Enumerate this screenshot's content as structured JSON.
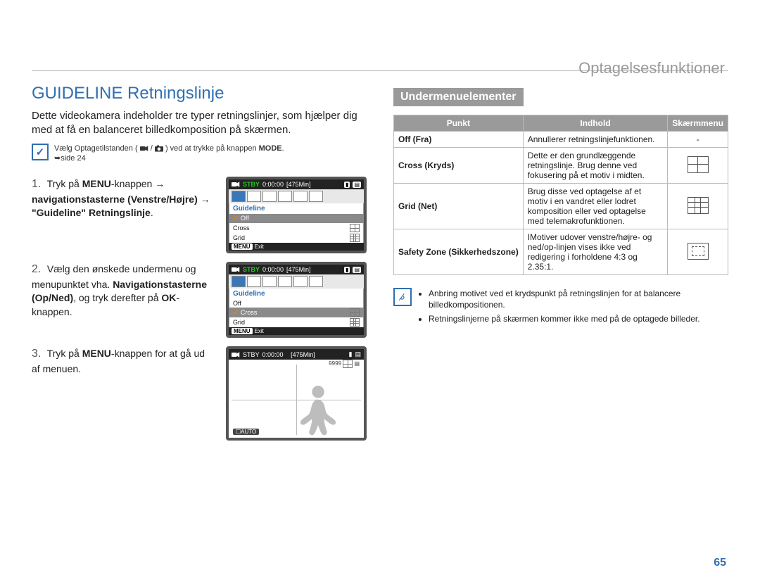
{
  "header": {
    "section": "Optagelsesfunktioner"
  },
  "page_number": "65",
  "left": {
    "title": "GUIDELINE Retningslinje",
    "intro": "Dette videokamera indeholder tre typer retningslinjer, som hjælper dig med at få en balanceret billedkomposition på skærmen.",
    "mode_note_pre": "Vælg Optagetilstanden (",
    "mode_note_mid": " / ",
    "mode_note_post": ") ved at trykke på knappen ",
    "mode_btn": "MODE",
    "mode_note_end": ".",
    "page_ref": "➥side 24",
    "step1_num": "1.",
    "step1_a": "Tryk på ",
    "step1_menu": "MENU",
    "step1_b": "-knappen → ",
    "step1_c": "navigationstasterne (Venstre/Højre) → \"Guideline\" Retningslinje",
    "step1_d": ".",
    "step2_num": "2.",
    "step2_a": "Vælg den ønskede undermenu og menupunktet vha. ",
    "step2_b": "Navigationstasterne (Op/Ned)",
    "step2_c": ", og tryk derefter på ",
    "step2_ok": "OK",
    "step2_d": "-knappen.",
    "step3_num": "3.",
    "step3_a": "Tryk på ",
    "step3_menu": "MENU",
    "step3_b": "-knappen for at gå ud af menuen."
  },
  "lcd": {
    "stby": "STBY",
    "time": "0:00:00",
    "remain": "[475Min]",
    "count": "9999",
    "menu_title": "Guideline",
    "off": "Off",
    "cross": "Cross",
    "grid": "Grid",
    "menu_btn": "MENU",
    "exit": "Exit",
    "auto": "☐AUTO"
  },
  "right": {
    "sub_heading": "Undermenuelementer",
    "th1": "Punkt",
    "th2": "Indhold",
    "th3": "Skærmmenu",
    "rows": [
      {
        "pt": "Off (Fra)",
        "desc": "Annullerer retningslinjefunktionen.",
        "icon": "none",
        "dash": "-"
      },
      {
        "pt": "Cross (Kryds)",
        "desc": "Dette er den grundlæggende retningslinje. Brug denne ved fokusering på et motiv i midten.",
        "icon": "cross"
      },
      {
        "pt": "Grid (Net)",
        "desc": "Brug disse ved optagelse af et motiv i en vandret eller lodret komposition eller ved optagelse med telemakrofunktionen.",
        "icon": "grid"
      },
      {
        "pt": "Safety Zone (Sikkerhedszone)",
        "desc": "IMotiver udover venstre/højre- og ned/op-linjen vises ikke ved redigering i forholdene 4:3 og 2.35:1.",
        "icon": "safe"
      }
    ],
    "tip1": "Anbring motivet ved et krydspunkt på retningslinjen for at balancere billedkompositionen.",
    "tip2": "Retningslinjerne på skærmen kommer ikke med på de optagede billeder."
  }
}
